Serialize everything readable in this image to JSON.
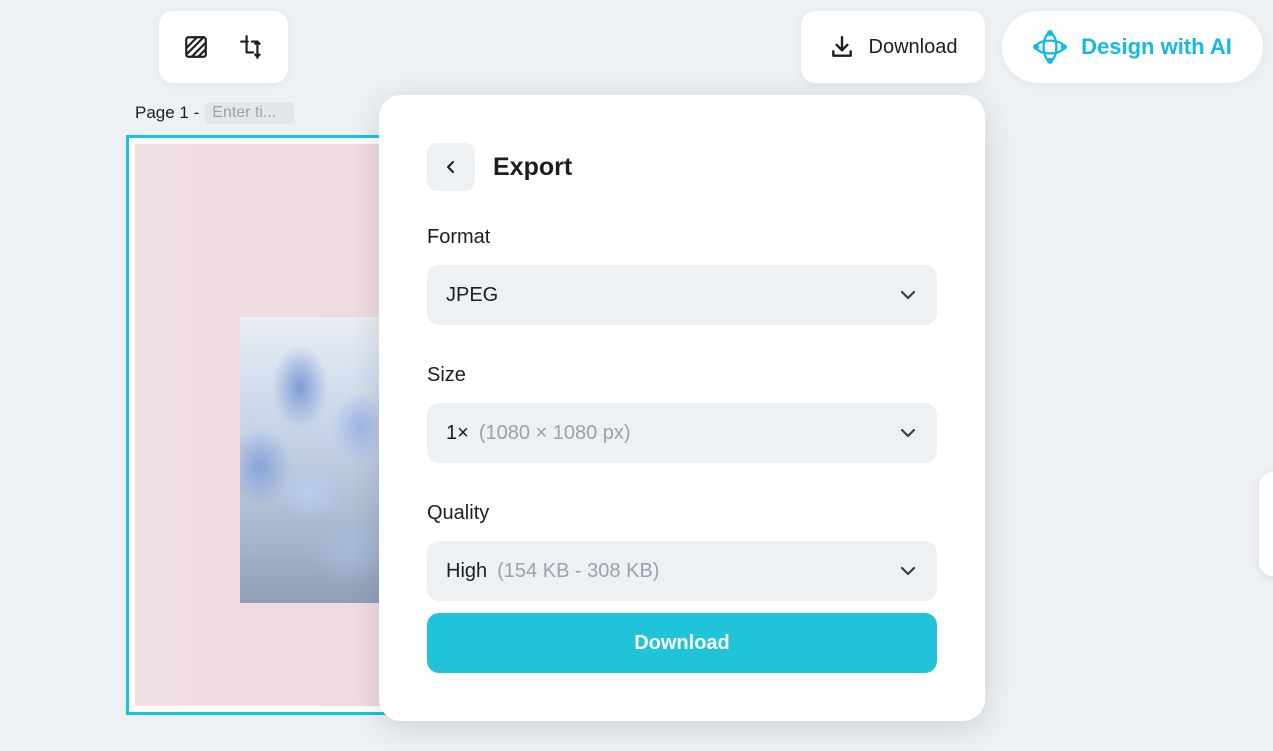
{
  "toolbar": {
    "tools": [
      {
        "icon": "transparency-icon"
      },
      {
        "icon": "resize-icon"
      }
    ]
  },
  "header": {
    "download_label": "Download",
    "download_icon": "download-icon",
    "ai_label": "Design with AI",
    "ai_icon": "ai-orbit-icon",
    "ai_color": "#15b8e6"
  },
  "page": {
    "label": "Page 1 -",
    "title_placeholder": "Enter ti..."
  },
  "export": {
    "title": "Export",
    "back_icon": "chevron-left-icon",
    "format": {
      "label": "Format",
      "value": "JPEG"
    },
    "size": {
      "label": "Size",
      "value": "1×",
      "hint": "(1080 × 1080 px)"
    },
    "quality": {
      "label": "Quality",
      "value": "High",
      "hint": "(154 KB - 308 KB)"
    },
    "download_label": "Download",
    "accent_color": "#20c3d8"
  }
}
